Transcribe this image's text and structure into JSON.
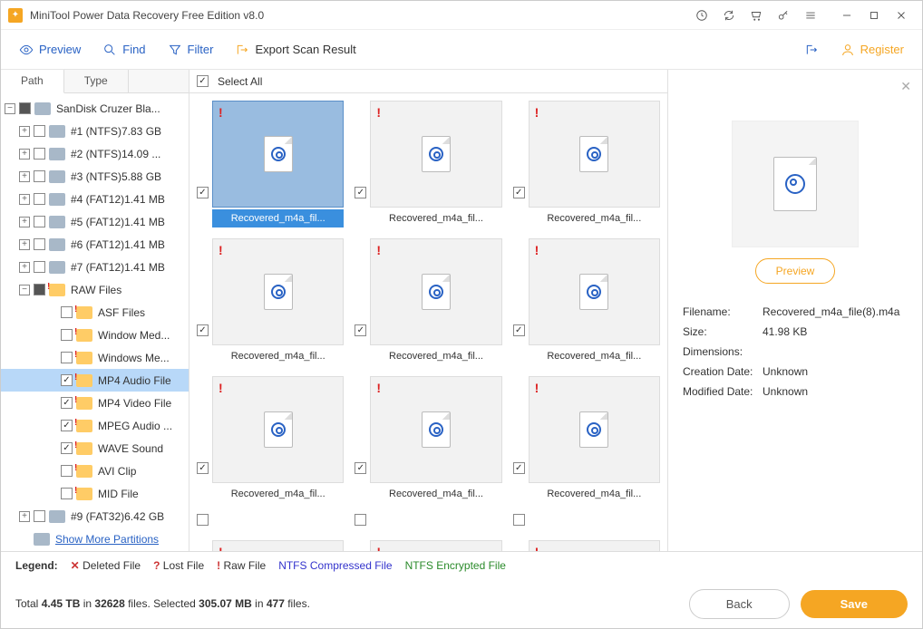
{
  "title": "MiniTool Power Data Recovery Free Edition v8.0",
  "toolbar": {
    "preview": "Preview",
    "find": "Find",
    "filter": "Filter",
    "export": "Export Scan Result",
    "register": "Register"
  },
  "tabs": {
    "path": "Path",
    "type": "Type"
  },
  "tree": {
    "root": "SanDisk Cruzer Bla...",
    "partitions": [
      "#1 (NTFS)7.83 GB",
      "#2 (NTFS)14.09 ...",
      "#3 (NTFS)5.88 GB",
      "#4 (FAT12)1.41 MB",
      "#5 (FAT12)1.41 MB",
      "#6 (FAT12)1.41 MB",
      "#7 (FAT12)1.41 MB"
    ],
    "raw_label": "RAW Files",
    "raw_children": [
      {
        "label": "ASF Files",
        "checked": false
      },
      {
        "label": "Window Med...",
        "checked": false
      },
      {
        "label": "Windows Me...",
        "checked": false
      },
      {
        "label": "MP4 Audio File",
        "checked": true,
        "selected": true
      },
      {
        "label": "MP4 Video File",
        "checked": true
      },
      {
        "label": "MPEG Audio ...",
        "checked": true
      },
      {
        "label": "WAVE Sound",
        "checked": true
      },
      {
        "label": "AVI Clip",
        "checked": false
      },
      {
        "label": "MID File",
        "checked": false
      }
    ],
    "p9": "#9 (FAT32)6.42 GB",
    "show_more": "Show More Partitions"
  },
  "select_all": "Select All",
  "files": [
    {
      "name": "Recovered_m4a_fil...",
      "selected": true
    },
    {
      "name": "Recovered_m4a_fil..."
    },
    {
      "name": "Recovered_m4a_fil..."
    },
    {
      "name": "Recovered_m4a_fil..."
    },
    {
      "name": "Recovered_m4a_fil..."
    },
    {
      "name": "Recovered_m4a_fil..."
    },
    {
      "name": "Recovered_m4a_fil..."
    },
    {
      "name": "Recovered_m4a_fil..."
    },
    {
      "name": "Recovered_m4a_fil..."
    }
  ],
  "preview": {
    "btn": "Preview",
    "filename_k": "Filename:",
    "filename_v": "Recovered_m4a_file(8).m4a",
    "size_k": "Size:",
    "size_v": "41.98 KB",
    "dim_k": "Dimensions:",
    "dim_v": "",
    "cdate_k": "Creation Date:",
    "cdate_v": "Unknown",
    "mdate_k": "Modified Date:",
    "mdate_v": "Unknown"
  },
  "legend": {
    "label": "Legend:",
    "deleted": "Deleted File",
    "lost": "Lost File",
    "raw": "Raw File",
    "ntfsc": "NTFS Compressed File",
    "ntfse": "NTFS Encrypted File"
  },
  "stats": {
    "p1": "Total ",
    "total_size": "4.45 TB",
    "p2": " in ",
    "total_files": "32628",
    "p3": " files.   Selected ",
    "sel_size": "305.07 MB",
    "p4": " in ",
    "sel_files": "477",
    "p5": " files."
  },
  "buttons": {
    "back": "Back",
    "save": "Save"
  }
}
